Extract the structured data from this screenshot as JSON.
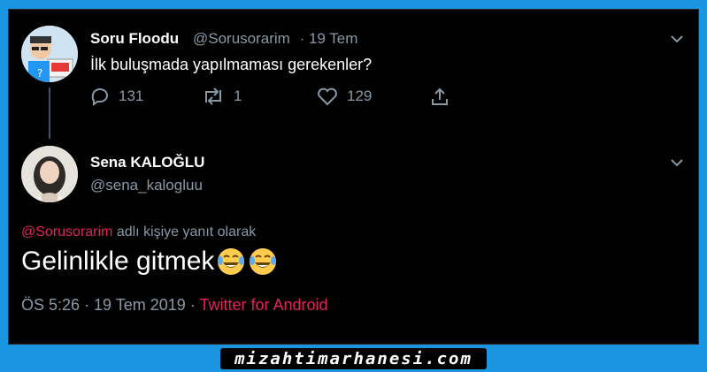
{
  "tweet1": {
    "name": "Soru Floodu",
    "handle": "@Sorusorarim",
    "date": "· 19 Tem",
    "text": "İlk buluşmada yapılmaması gerekenler?",
    "replies": "131",
    "retweets": "1",
    "likes": "129"
  },
  "tweet2": {
    "name": "Sena KALOĞLU",
    "handle": "@sena_kalogluu",
    "reply_mention": "@Sorusorarim",
    "reply_suffix": " adlı kişiye yanıt olarak",
    "text": "Gelinlikle gitmek",
    "time": "ÖS 5:26 · 19 Tem 2019 · ",
    "source": "Twitter for Android"
  },
  "watermark": "mizahtimarhanesi.com",
  "colors": {
    "accent": "#e0245e",
    "muted": "#8899a6",
    "border": "#1b95e0"
  }
}
